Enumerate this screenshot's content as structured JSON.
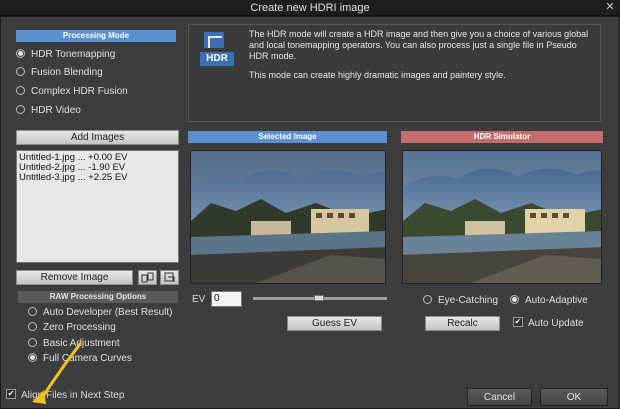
{
  "window": {
    "title": "Create new HDRI image",
    "close_glyph": "✕"
  },
  "processing_mode": {
    "header": "Processing Mode",
    "options": [
      {
        "label": "HDR Tonemapping",
        "selected": true
      },
      {
        "label": "Fusion Blending",
        "selected": false
      },
      {
        "label": "Complex HDR Fusion",
        "selected": false
      },
      {
        "label": "HDR Video",
        "selected": false
      }
    ]
  },
  "description": {
    "icon_text": "HDR",
    "line1": "The HDR mode will create a HDR image and then give you a choice of various global and local tonemapping operators. You can also process just a single file in Pseudo HDR mode.",
    "line2": "This mode can create highly dramatic images and paintery style."
  },
  "files": {
    "add_button": "Add Images",
    "items": [
      "Untitled-1.jpg ... +0.00 EV",
      "Untitled-2.jpg ... -1.90 EV",
      "Untitled-3.jpg ... +2.25 EV"
    ],
    "remove_button": "Remove Image"
  },
  "raw": {
    "header": "RAW Processing Options",
    "options": [
      {
        "label": "Auto Developer (Best Result)",
        "selected": false
      },
      {
        "label": "Zero Processing",
        "selected": false
      },
      {
        "label": "Basic Adjustment",
        "selected": false
      },
      {
        "label": "Full Camera Curves",
        "selected": true
      }
    ]
  },
  "selected_image": {
    "header": "Selected Image"
  },
  "ev": {
    "label": "EV",
    "value": "0",
    "guess_button": "Guess EV"
  },
  "simulator": {
    "header": "HDR Simulator",
    "eye_catching": "Eye-Catching",
    "auto_adaptive": "Auto-Adaptive",
    "auto_adaptive_selected": true,
    "recalc_button": "Recalc",
    "auto_update_label": "Auto Update",
    "auto_update_checked": true
  },
  "footer": {
    "align_label": "Align Files in Next Step",
    "align_checked": true,
    "cancel": "Cancel",
    "ok": "OK"
  },
  "colors": {
    "accent_blue": "#5a8fd0",
    "accent_salmon": "#c56c6c",
    "arrow_yellow": "#f2c418"
  }
}
